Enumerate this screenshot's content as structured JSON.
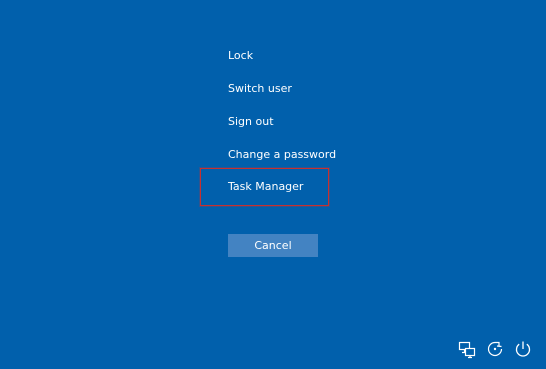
{
  "security_screen": {
    "background_color": "#0160ac",
    "options": [
      {
        "key": "lock",
        "label": "Lock"
      },
      {
        "key": "switch_user",
        "label": "Switch user"
      },
      {
        "key": "sign_out",
        "label": "Sign out"
      },
      {
        "key": "change_password",
        "label": "Change a password"
      },
      {
        "key": "task_manager",
        "label": "Task Manager"
      }
    ],
    "highlighted_option": "task_manager",
    "highlight_color": "#c8302f",
    "cancel_label": "Cancel",
    "cancel_color": "#4383c2"
  },
  "tray": {
    "icons": [
      "network-icon",
      "ease-of-access-icon",
      "power-icon"
    ]
  }
}
